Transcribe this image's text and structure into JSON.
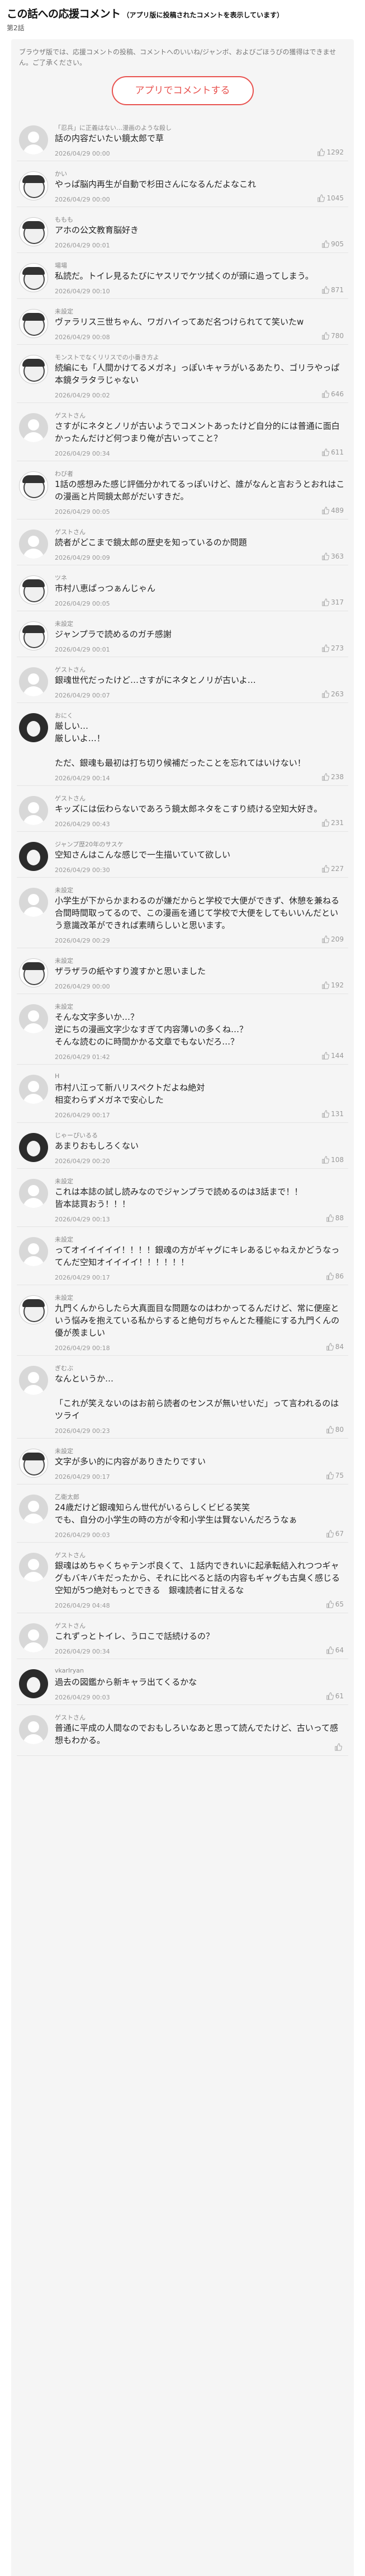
{
  "header": {
    "title": "この話への応援コメント",
    "title_note": "（アプリ版に投稿されたコメントを表示しています）",
    "episode": "第2話"
  },
  "notice": "ブラウザ版では、応援コメントの投稿、コメントへのいいね/ジャンボ、およびごほうびの獲得はできません。ご了承ください。",
  "cta_label": "アプリでコメントする",
  "comments": [
    {
      "name": "「忍兵」に正義はない…漫画のような殺し",
      "text": "話の内容だいたい鏡太郎で草",
      "date": "2026/04/29 00:00",
      "likes": "1292",
      "avatar": "default"
    },
    {
      "name": "かい",
      "text": "やっぱ脳内再生が自動で杉田さんになるんだよなこれ",
      "date": "2026/04/29 00:00",
      "likes": "1045",
      "avatar": "manga"
    },
    {
      "name": "ももも",
      "text": "アホの公文教育脳好き",
      "date": "2026/04/29 00:01",
      "likes": "905",
      "avatar": "manga"
    },
    {
      "name": "場場",
      "text": "私読だ。トイレ見るたびにヤスリでケツ拭くのが頭に過ってしまう。",
      "date": "2026/04/29 00:10",
      "likes": "871",
      "avatar": "manga"
    },
    {
      "name": "未設定",
      "text": "ヴァラリス三世ちゃん、ワガハイってあだ名つけられてて笑いたw",
      "date": "2026/04/29 00:08",
      "likes": "780",
      "avatar": "manga"
    },
    {
      "name": "モンストでなくリリスでの小番き方よ",
      "text": "続編にも「人間かけてるメガネ」っぽいキャラがいるあたり、ゴリラやっぱ本鏡タラタラじゃない",
      "date": "2026/04/29 00:02",
      "likes": "646",
      "avatar": "manga"
    },
    {
      "name": "ゲストさん",
      "text": "さすがにネタとノリが古いようでコメントあったけど自分的には普通に面白かったんだけど何つまり俺が古いってこと？",
      "date": "2026/04/29 00:34",
      "likes": "611",
      "avatar": "default"
    },
    {
      "name": "わび者",
      "text": "1話の感想みた感じ評価分かれてるっぽいけど、誰がなんと言おうとおれはこの漫画と片岡鏡太郎がだいすきだ。",
      "date": "2026/04/29 00:05",
      "likes": "489",
      "avatar": "manga"
    },
    {
      "name": "ゲストさん",
      "text": "読者がどこまで鏡太郎の歴史を知っているのか問題",
      "date": "2026/04/29 00:09",
      "likes": "363",
      "avatar": "default"
    },
    {
      "name": "ツネ",
      "text": "市村八恵ぱっつぁんじゃん",
      "date": "2026/04/29 00:05",
      "likes": "317",
      "avatar": "manga"
    },
    {
      "name": "未設定",
      "text": "ジャンプラで読めるのガチ感謝",
      "date": "2026/04/29 00:01",
      "likes": "273",
      "avatar": "manga"
    },
    {
      "name": "ゲストさん",
      "text": "銀魂世代だったけど…さすがにネタとノリが古いよ…",
      "date": "2026/04/29 00:07",
      "likes": "263",
      "avatar": "default"
    },
    {
      "name": "おにく",
      "text": "厳しい…\n厳しいよ…！\n\nただ、銀魂も最初は打ち切り候補だったことを忘れてはいけない！",
      "date": "2026/04/29 00:14",
      "likes": "238",
      "avatar": "dark"
    },
    {
      "name": "ゲストさん",
      "text": "キッズには伝わらないであろう鏡太郎ネタをこすり続ける空知大好き。",
      "date": "2026/04/29 00:43",
      "likes": "231",
      "avatar": "default"
    },
    {
      "name": "ジャンプ歴20年のサスケ",
      "text": "空知さんはこんな感じで一生描いていて欲しい",
      "date": "2026/04/29 00:30",
      "likes": "227",
      "avatar": "dark"
    },
    {
      "name": "未設定",
      "text": "小学生が下からかまわるのが嫌だからと学校で大便ができず、休憩を兼ねる合間時間取ってるので、この漫画を通じて学校で大便をしてもいいんだという意識改革ができれば素晴らしいと思います。",
      "date": "2026/04/29 00:29",
      "likes": "209",
      "avatar": "default"
    },
    {
      "name": "未設定",
      "text": "ザラザラの紙やすり渡すかと思いました",
      "date": "2026/04/29 00:00",
      "likes": "192",
      "avatar": "manga"
    },
    {
      "name": "未設定",
      "text": "そんな文字多いか…？\n逆にちの漫画文字少なすぎて内容薄いの多くね…？\nそんな読むのに時間かかる文章でもないだろ…？",
      "date": "2026/04/29 01:42",
      "likes": "144",
      "avatar": "default"
    },
    {
      "name": "H",
      "text": "市村八江って新八リスペクトだよね絶対\n相変わらずメガネで安心した",
      "date": "2026/04/29 00:17",
      "likes": "131",
      "avatar": "default"
    },
    {
      "name": "じゃーぴいるる",
      "text": "あまりおもしろくない",
      "date": "2026/04/29 00:20",
      "likes": "108",
      "avatar": "dark"
    },
    {
      "name": "未設定",
      "text": "これは本誌の試し読みなのでジャンプラで読めるのは3話まで！！\n皆本誌買おう！！！",
      "date": "2026/04/29 00:13",
      "likes": "88",
      "avatar": "default"
    },
    {
      "name": "未設定",
      "text": "ってオイイイイイ！！！！銀魂の方がギャグにキレあるじゃねえかどうなってんだ空知オイイイイ！！！！！！",
      "date": "2026/04/29 00:17",
      "likes": "86",
      "avatar": "default"
    },
    {
      "name": "未設定",
      "text": "九門くんからしたら大真面目な問題なのはわかってるんだけど、常に便座という悩みを抱えている私からすると絶句ガちゃんとた種能にする九門くんの優が羨ましい",
      "date": "2026/04/29 00:18",
      "likes": "84",
      "avatar": "manga"
    },
    {
      "name": "ぎむぶ",
      "text": "なんというか…\n\n「これが笑えないのはお前ら読者のセンスが無いせいだ」って言われるのはツライ",
      "date": "2026/04/29 00:23",
      "likes": "80",
      "avatar": "default"
    },
    {
      "name": "未設定",
      "text": "文字が多い的に内容がありきたりですい",
      "date": "2026/04/29 00:17",
      "likes": "75",
      "avatar": "manga"
    },
    {
      "name": "乙衛太郎",
      "text": "24歳だけど銀魂知らん世代がいるらしくビビる笑笑\nでも、自分の小学生の時の方が令和小学生は賢ないんだろうなぁ",
      "date": "2026/04/29 00:03",
      "likes": "67",
      "avatar": "default"
    },
    {
      "name": "ゲストさん",
      "text": "銀魂はめちゃくちゃテンポ良くて、１話内できれいに起承転結入れつつギャグもバキバキだったから、それに比べると話の内容もギャグも古臭く感じる\n空知が5つ絶対もっとできる　銀魂読者に甘えるな",
      "date": "2026/04/29 04:48",
      "likes": "65",
      "avatar": "default"
    },
    {
      "name": "ゲストさん",
      "text": "これずっとトイレ、うロこで話続けるの？",
      "date": "2026/04/29 00:34",
      "likes": "64",
      "avatar": "default"
    },
    {
      "name": "vkarIryan",
      "text": "過去の図鑑から新キャラ出てくるかな",
      "date": "2026/04/29 00:03",
      "likes": "61",
      "avatar": "dark"
    },
    {
      "name": "ゲストさん",
      "text": "普通に平成の人間なのでおもしろいなあと思って読んでたけど、古いって感想もわかる。",
      "date": "",
      "likes": "",
      "avatar": "default"
    }
  ]
}
